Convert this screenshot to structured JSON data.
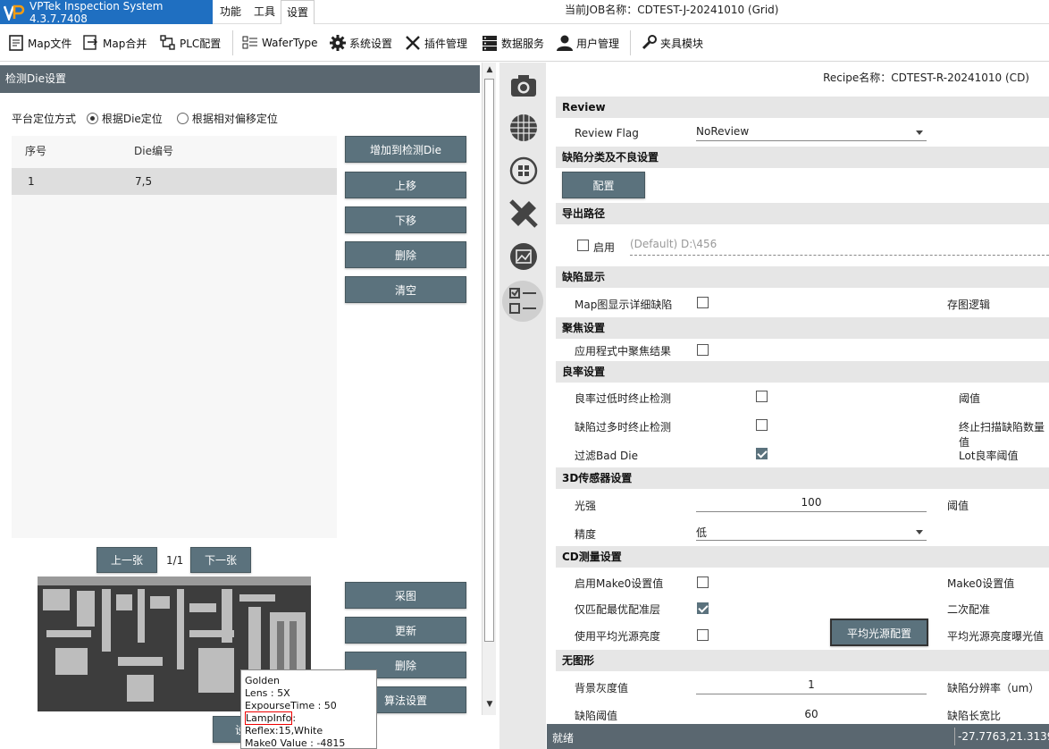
{
  "app": {
    "title": "VPTek Inspection System 4.3.7.7408",
    "job_label": "当前JOB名称：CDTEST-J-20241010 (Grid)"
  },
  "menus": [
    "功能",
    "工具",
    "设置"
  ],
  "toolbar": [
    "Map文件",
    "Map合并",
    "PLC配置",
    "WaferType",
    "系统设置",
    "插件管理",
    "数据服务",
    "用户管理",
    "夹具模块"
  ],
  "left": {
    "header": "检测Die设置",
    "positioning_label": "平台定位方式",
    "radio_die": "根据Die定位",
    "radio_offset": "根据相对偏移定位",
    "columns": [
      "序号",
      "Die编号"
    ],
    "rows": [
      {
        "index": "1",
        "die": "7,5"
      }
    ],
    "buttons": {
      "add": "增加到检测Die",
      "up": "上移",
      "down": "下移",
      "delete": "删除",
      "clear": "清空"
    },
    "pager": {
      "prev": "上一张",
      "page": "1/1",
      "next": "下一张"
    },
    "image_buttons": {
      "capture": "采图",
      "update": "更新",
      "delete": "删除",
      "algo": "算法设置"
    },
    "hidden_button": "设"
  },
  "tooltip": {
    "line1": "Golden",
    "line2": "Lens : 5X",
    "line3": "ExpourseTime : 50",
    "lamp_key": "LampInfo",
    "lamp_val": ": Reflex:15,White",
    "line5": "Make0 Value : -4815"
  },
  "right": {
    "recipe": "Recipe名称：CDTEST-R-20241010 (CD)",
    "review": {
      "title": "Review",
      "flag_label": "Review Flag",
      "flag_value": "NoReview"
    },
    "defect_class": {
      "title": "缺陷分类及不良设置",
      "config_button": "配置"
    },
    "export": {
      "title": "导出路径",
      "enable_label": "启用",
      "path_placeholder": "(Default) D:\\456"
    },
    "defect_display": {
      "title": "缺陷显示",
      "map_detail": "Map图显示详细缺陷",
      "save_logic": "存图逻辑"
    },
    "focus": {
      "title": "聚焦设置",
      "apply_focus": "应用程式中聚焦结果"
    },
    "yield": {
      "title": "良率设置",
      "low_stop": "良率过低时终止检测",
      "threshold": "阈值",
      "many_stop": "缺陷过多时终止检测",
      "stop_count": "终止扫描缺陷数量值",
      "filter_bad": "过滤Bad Die",
      "lot_threshold": "Lot良率阈值"
    },
    "sensor3d": {
      "title": "3D传感器设置",
      "intensity_label": "光强",
      "intensity_value": "100",
      "threshold": "阈值",
      "precision_label": "精度",
      "precision_value": "低"
    },
    "cd": {
      "title": "CD测量设置",
      "make0_enable": "启用Make0设置值",
      "make0_value": "Make0设置值",
      "best_layer": "仅匹配最优配准层",
      "second_reg": "二次配准",
      "avg_light": "使用平均光源亮度",
      "avg_light_button": "平均光源配置",
      "avg_exposure": "平均光源亮度曝光值"
    },
    "nopattern": {
      "title": "无图形",
      "bg_gray_label": "背景灰度值",
      "bg_gray_value": "1",
      "resolution": "缺陷分辨率（um）",
      "defect_threshold_label": "缺陷阈值",
      "defect_threshold_value": "60",
      "aspect": "缺陷长宽比"
    }
  },
  "status": {
    "text": "就绪",
    "coords": "-27.7763,21.3139,0"
  }
}
